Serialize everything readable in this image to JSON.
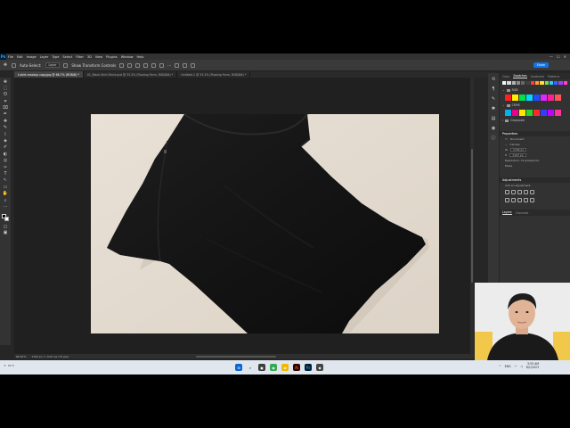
{
  "app": {
    "logo": "Ps",
    "menu": [
      "File",
      "Edit",
      "Image",
      "Layer",
      "Type",
      "Select",
      "Filter",
      "3D",
      "View",
      "Plugins",
      "Window",
      "Help"
    ],
    "window_controls": [
      "—",
      "☐",
      "✕"
    ]
  },
  "options_bar": {
    "auto_select_label": "Auto-Select:",
    "auto_select_value": "Layer",
    "transform_label": "Show Transform Controls",
    "more_label": "···",
    "share_label": "Share"
  },
  "tabs": [
    {
      "label": "t-shirt-mockup copy.jpg @ 66.7% (RGB/8) *",
      "active": true
    },
    {
      "label": "01_Black-Shirt-Tshirt.psd @ 33.3% (Flowing Form, RGB/8#) *",
      "active": false
    },
    {
      "label": "Untitled-1 @ 33.3% (Flowing Form, RGB/8#) *",
      "active": false
    }
  ],
  "tools": [
    "✥",
    "⬚",
    "ʘ",
    "⌗",
    "⌧",
    "✒",
    "✚",
    "✎",
    "⌇",
    "◈",
    "✐",
    "◐",
    "◎",
    "✑",
    "T",
    "↖",
    "▭",
    "✋",
    "⌕",
    "···"
  ],
  "status": {
    "zoom": "66.67%",
    "doc_info": "1792 px × 1197 px (72 ppi)"
  },
  "panel": {
    "tabs": [
      "Color",
      "Swatches",
      "Gradients",
      "Patterns"
    ],
    "active_tab": "Swatches",
    "top_swatches": [
      "#f5f5f5",
      "#d9d9d9",
      "#b3b3b3",
      "#8c8c8c",
      "#666666",
      "#404040",
      "#ff3b3b",
      "#ff9c33",
      "#ffe033",
      "#6ee04b",
      "#33c7ff",
      "#3366ff",
      "#9b44ff",
      "#ff44c6"
    ],
    "groups": [
      {
        "name": "RGB",
        "colors": [
          "#ff1f1f",
          "#ffee00",
          "#00e04a",
          "#00d9ff",
          "#1f4dff",
          "#d92bff",
          "#ff1f8f",
          "#ff5555"
        ]
      },
      {
        "name": "CMYK",
        "colors": [
          "#00b3f0",
          "#e8008a",
          "#ffe600",
          "#2bd42b",
          "#ff2a2a",
          "#3a3aff",
          "#c300ff",
          "#ff3399"
        ]
      },
      {
        "name": "Grayscale",
        "colors": []
      }
    ],
    "properties_title": "Properties",
    "doc_label": "Document",
    "canvas_label": "Canvas",
    "width_value": "1792 px",
    "height_value": "1197 px",
    "resolution_label": "Resolution: 72 pixels/inch",
    "mode_label": "Mode",
    "adjustments_title": "Adjustments",
    "adjustments_sub": "Add an adjustment",
    "layers_tabs": [
      "Layers",
      "Channels"
    ]
  },
  "taskbar": {
    "weather": "31°C",
    "tray": [
      "^",
      "ENG"
    ],
    "time": "3:55 AM",
    "date": "6/1/2023"
  }
}
